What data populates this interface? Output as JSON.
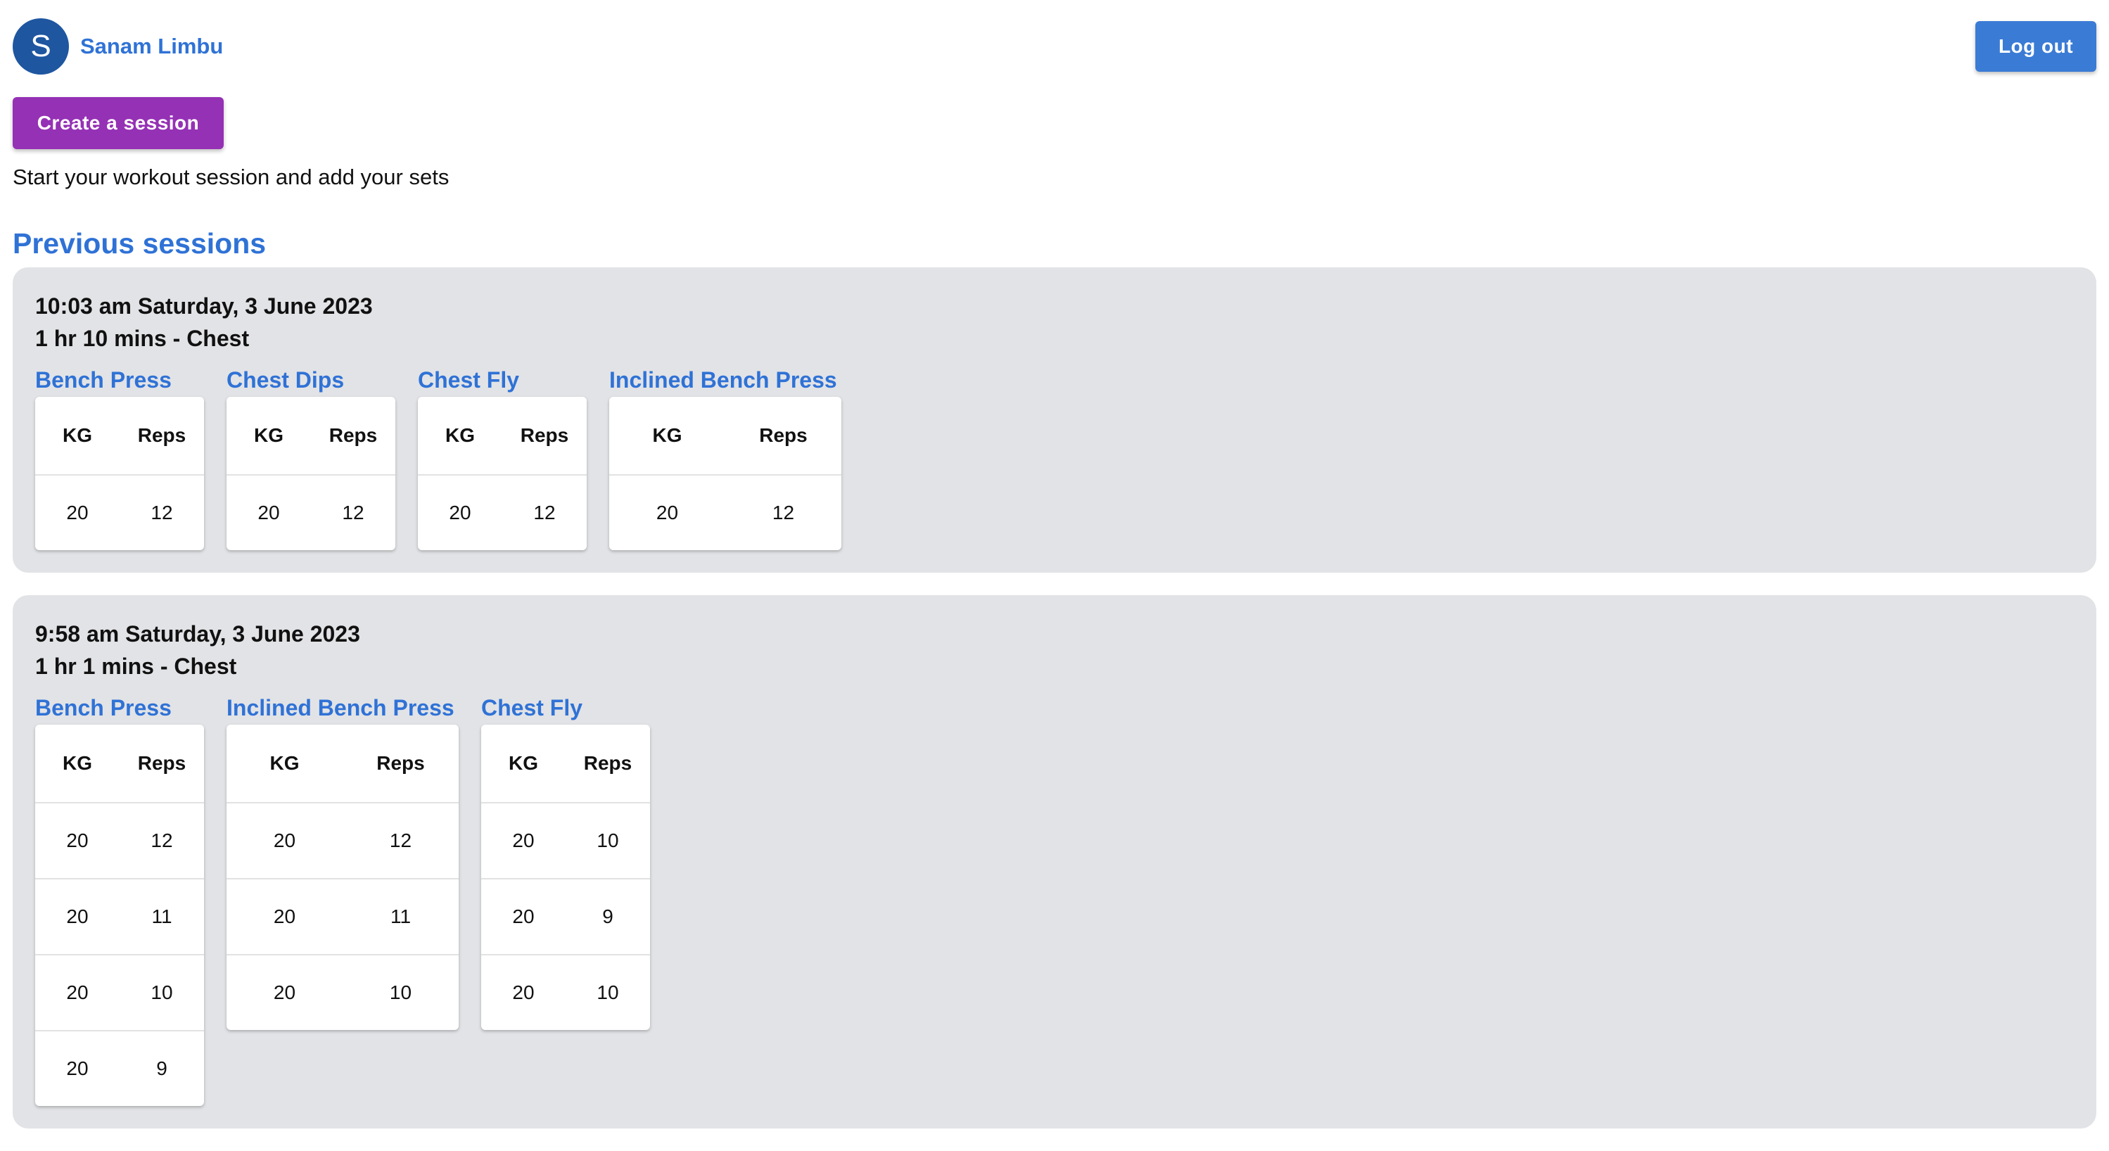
{
  "user": {
    "avatar_initial": "S",
    "name": "Sanam Limbu"
  },
  "header": {
    "logout_label": "Log out"
  },
  "actions": {
    "create_session_label": "Create a session",
    "intro_text": "Start your workout session and add your sets"
  },
  "previous_sessions_title": "Previous sessions",
  "table_headers": {
    "kg": "KG",
    "reps": "Reps"
  },
  "sessions": [
    {
      "time": "10:03 am Saturday, 3 June 2023",
      "summary": "1 hr 10 mins - Chest",
      "exercises": [
        {
          "name": "Bench Press",
          "sets": [
            {
              "kg": "20",
              "reps": "12"
            }
          ]
        },
        {
          "name": "Chest Dips",
          "sets": [
            {
              "kg": "20",
              "reps": "12"
            }
          ]
        },
        {
          "name": "Chest Fly",
          "sets": [
            {
              "kg": "20",
              "reps": "12"
            }
          ]
        },
        {
          "name": "Inclined Bench Press",
          "sets": [
            {
              "kg": "20",
              "reps": "12"
            }
          ]
        }
      ]
    },
    {
      "time": "9:58 am Saturday, 3 June 2023",
      "summary": "1 hr 1 mins - Chest",
      "exercises": [
        {
          "name": "Bench Press",
          "sets": [
            {
              "kg": "20",
              "reps": "12"
            },
            {
              "kg": "20",
              "reps": "11"
            },
            {
              "kg": "20",
              "reps": "10"
            },
            {
              "kg": "20",
              "reps": "9"
            }
          ]
        },
        {
          "name": "Inclined Bench Press",
          "sets": [
            {
              "kg": "20",
              "reps": "12"
            },
            {
              "kg": "20",
              "reps": "11"
            },
            {
              "kg": "20",
              "reps": "10"
            }
          ]
        },
        {
          "name": "Chest Fly",
          "sets": [
            {
              "kg": "20",
              "reps": "10"
            },
            {
              "kg": "20",
              "reps": "9"
            },
            {
              "kg": "20",
              "reps": "10"
            }
          ]
        }
      ]
    }
  ]
}
